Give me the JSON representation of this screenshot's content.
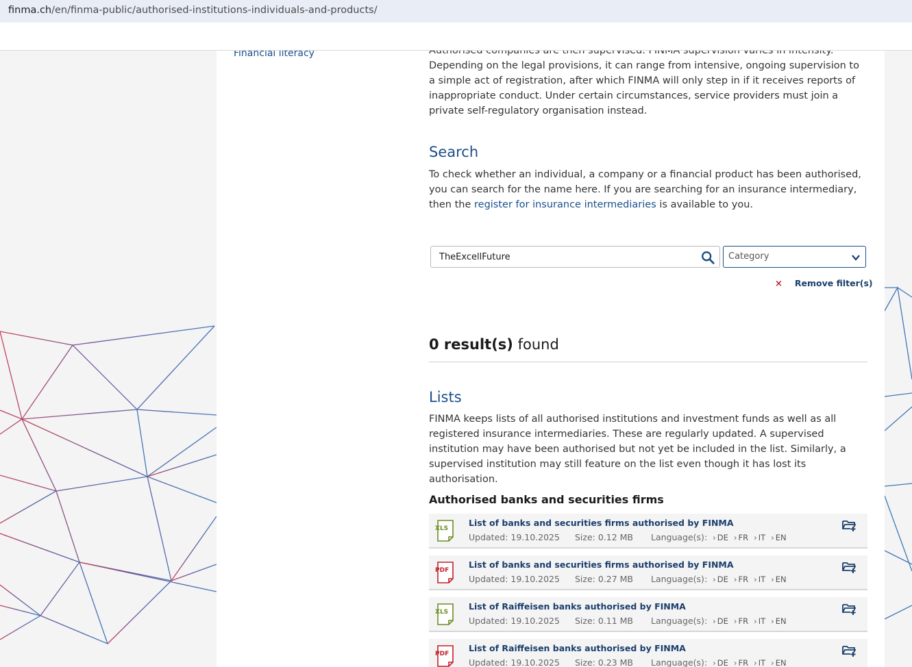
{
  "browser": {
    "url_host": "finma.ch",
    "url_path": "/en/finma-public/authorised-institutions-individuals-and-products/"
  },
  "sidebar": {
    "link": "Financial literacy"
  },
  "intro": {
    "line0": "Authorised companies are then supervised. FINMA supervision varies in intensity. Depending",
    "rest": "on the legal provisions, it can range from intensive, ongoing supervision to a simple act of registration, after which FINMA will only step in if it receives reports of inappropriate conduct. Under certain circumstances, service providers must join a private self-regulatory organisation instead."
  },
  "search": {
    "heading": "Search",
    "text_before": "To check whether an individual, a company or a financial product has been authorised, you can search for the name here. If you are searching for an insurance intermediary, then the ",
    "link": "register for insurance intermediaries",
    "text_after": " is available to you.",
    "query": "TheExcellFuture",
    "category_placeholder": "Category",
    "remove_filter": "Remove filter(s)",
    "remove_icon": "×"
  },
  "results": {
    "count": "0 result(s)",
    "suffix": " found"
  },
  "lists": {
    "heading": "Lists",
    "text": "FINMA keeps lists of all authorised institutions and investment funds as well as all registered insurance intermediaries. These are regularly updated. A supervised institution may have been authorised but not yet be included in the list. Similarly, a supervised institution may still feature on the list even though it has lost its authorisation.",
    "subheading": "Authorised banks and securities firms",
    "items": [
      {
        "type": "XLS",
        "title": "List of banks and securities firms authorised by FINMA",
        "updated": "Updated: 19.10.2025",
        "size": "Size: 0.12  MB",
        "lang_label": "Language(s):",
        "langs": [
          "DE",
          "FR",
          "IT",
          "EN"
        ]
      },
      {
        "type": "PDF",
        "title": "List of banks and securities firms authorised by FINMA",
        "updated": "Updated: 19.10.2025",
        "size": "Size: 0.27  MB",
        "lang_label": "Language(s):",
        "langs": [
          "DE",
          "FR",
          "IT",
          "EN"
        ]
      },
      {
        "type": "XLS",
        "title": "List of Raiffeisen banks authorised by FINMA",
        "updated": "Updated: 19.10.2025",
        "size": "Size: 0.11  MB",
        "lang_label": "Language(s):",
        "langs": [
          "DE",
          "FR",
          "IT",
          "EN"
        ]
      },
      {
        "type": "PDF",
        "title": "List of Raiffeisen banks authorised by FINMA",
        "updated": "Updated: 19.10.2025",
        "size": "Size: 0.23  MB",
        "lang_label": "Language(s):",
        "langs": [
          "DE",
          "FR",
          "IT",
          "EN"
        ]
      }
    ]
  },
  "colors": {
    "brand_blue": "#1a4f8b",
    "xls_green": "#6b8e23",
    "pdf_red": "#c0202a",
    "remove_red": "#c0202a"
  },
  "icons": {
    "search": "search-icon",
    "dropdown": "chevron-down-icon",
    "folder": "folder-plus-icon",
    "xls": "xls-file-icon",
    "pdf": "pdf-file-icon"
  }
}
